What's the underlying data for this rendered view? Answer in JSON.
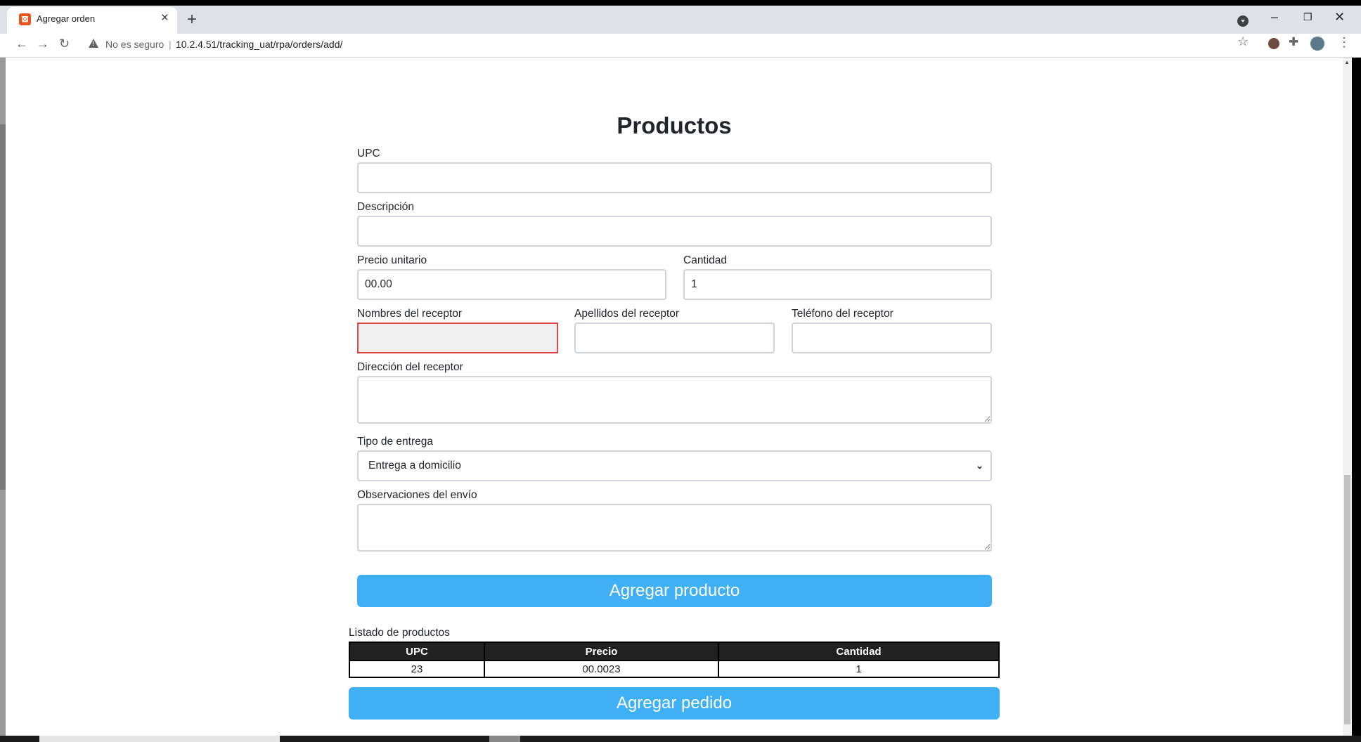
{
  "browser": {
    "tab_title": "Agregar orden",
    "security_label": "No es seguro",
    "url_separator": "|",
    "url": "10.2.4.51/tracking_uat/rpa/orders/add/"
  },
  "form": {
    "title": "Productos",
    "upc_label": "UPC",
    "upc_value": "",
    "descripcion_label": "Descripción",
    "descripcion_value": "",
    "precio_label": "Precio unitario",
    "precio_value": "00.00",
    "cantidad_label": "Cantidad",
    "cantidad_value": "1",
    "nombres_label": "Nombres del receptor",
    "nombres_value": "",
    "apellidos_label": "Apellidos del receptor",
    "apellidos_value": "",
    "telefono_label": "Teléfono del receptor",
    "telefono_value": "",
    "direccion_label": "Dirección del receptor",
    "tipo_label": "Tipo de entrega",
    "tipo_value": "Entrega a domicilio",
    "observaciones_label": "Observaciones del envío",
    "add_product_button": "Agregar producto"
  },
  "list": {
    "label": "Listado de productos",
    "columns": [
      "UPC",
      "Precio",
      "Cantidad"
    ],
    "rows": [
      [
        "23",
        "00.0023",
        "1"
      ]
    ],
    "add_order_button": "Agregar pedido"
  }
}
